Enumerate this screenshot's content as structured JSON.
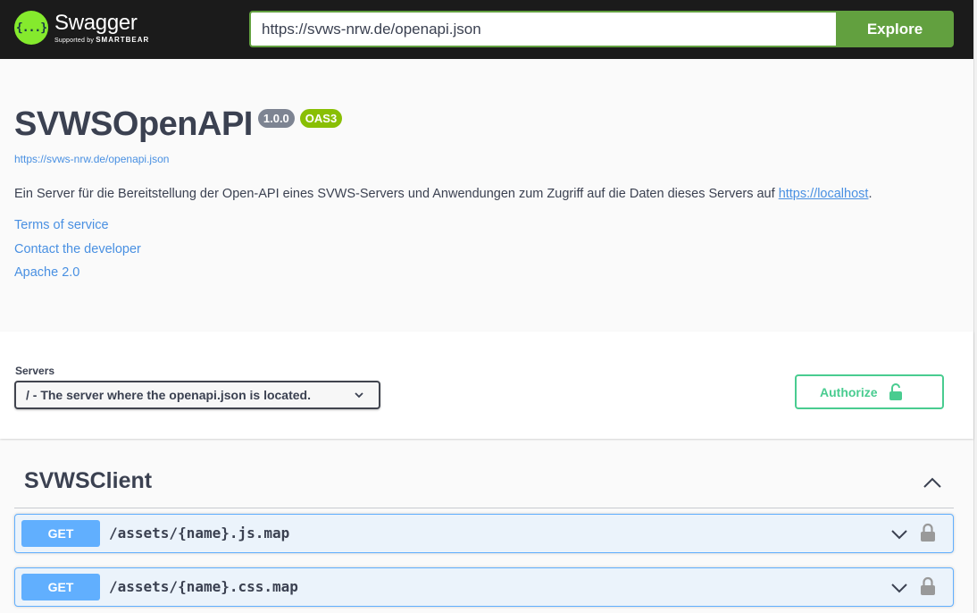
{
  "topbar": {
    "logo_title": "Swagger",
    "logo_supported": "Supported by",
    "logo_brand": "SMARTBEAR",
    "logo_glyph": "{...}",
    "url_value": "https://svws-nrw.de/openapi.json",
    "explore_label": "Explore"
  },
  "info": {
    "title": "SVWSOpenAPI",
    "version": "1.0.0",
    "oas": "OAS3",
    "spec_url": "https://svws-nrw.de/openapi.json",
    "description_text": "Ein Server für die Bereitstellung der Open-API eines SVWS-Servers und Anwendungen zum Zugriff auf die Daten dieses Servers auf ",
    "description_link": "https://localhost",
    "description_end": ".",
    "terms": "Terms of service",
    "contact": "Contact the developer",
    "license": "Apache 2.0"
  },
  "servers": {
    "label": "Servers",
    "selected": "/ - The server where the openapi.json is located.",
    "authorize_label": "Authorize"
  },
  "tag": {
    "name": "SVWSClient",
    "operations": [
      {
        "method": "GET",
        "path": "/assets/{name}.js.map"
      },
      {
        "method": "GET",
        "path": "/assets/{name}.css.map"
      }
    ]
  },
  "colors": {
    "topbar_bg": "#1b1b1b",
    "accent_green": "#62a03f",
    "get_blue": "#61affe",
    "authorize_green": "#49cc90",
    "link_blue": "#4990e2",
    "oas_badge": "#89bf04",
    "version_badge": "#7d8492"
  },
  "icons": [
    "swagger-logo-icon",
    "chevron-down-icon",
    "unlocked-icon",
    "chevron-up-icon",
    "locked-icon"
  ]
}
